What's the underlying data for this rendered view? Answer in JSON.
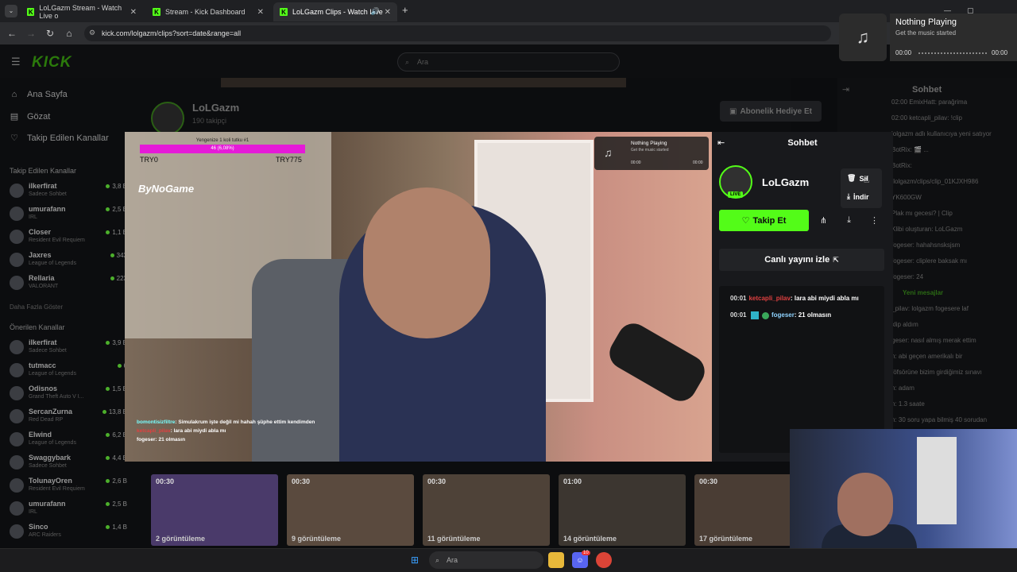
{
  "browser": {
    "tabs": [
      {
        "label": "LoLGazm Stream - Watch Live o"
      },
      {
        "label": "Stream - Kick Dashboard"
      },
      {
        "label": "LoLGazm Clips - Watch Live"
      }
    ],
    "new_tab": "+",
    "url": "kick.com/lolgazm/clips?sort=date&range=all"
  },
  "kick": {
    "logo": "KICK",
    "search_placeholder": "Ara"
  },
  "sidebar": {
    "nav": [
      {
        "label": "Ana Sayfa",
        "icon": "home-icon"
      },
      {
        "label": "Gözat",
        "icon": "browse-icon"
      },
      {
        "label": "Takip Edilen Kanallar",
        "icon": "heart-icon"
      }
    ],
    "followed_heading": "Takip Edilen Kanallar",
    "followed": [
      {
        "name": "ilkerfirat",
        "game": "Sadece Sohbet",
        "viewers": "3,8 B"
      },
      {
        "name": "umurafann",
        "game": "IRL",
        "viewers": "2,5 B"
      },
      {
        "name": "Closer",
        "game": "Resident Evil Requiem",
        "viewers": "1,1 B"
      },
      {
        "name": "Jaxres",
        "game": "League of Legends",
        "viewers": "343"
      },
      {
        "name": "Rellaria",
        "game": "VALORANT",
        "viewers": "223"
      }
    ],
    "show_more": "Daha Fazla Göster",
    "recommended_heading": "Önerilen Kanallar",
    "recommended": [
      {
        "name": "ilkerfirat",
        "game": "Sadece Sohbet",
        "viewers": "3,9 B"
      },
      {
        "name": "tutmacc",
        "game": "League of Legends",
        "viewers": "6"
      },
      {
        "name": "Odisnos",
        "game": "Grand Theft Auto V I...",
        "viewers": "1,5 B"
      },
      {
        "name": "SercanZurna",
        "game": "Red Dead RP",
        "viewers": "13,8 B"
      },
      {
        "name": "Elwind",
        "game": "League of Legends",
        "viewers": "6,2 B"
      },
      {
        "name": "Swaggybark",
        "game": "Sadece Sohbet",
        "viewers": "4,4 B"
      },
      {
        "name": "TolunayOren",
        "game": "Resident Evil Requiem",
        "viewers": "2,6 B"
      },
      {
        "name": "umurafann",
        "game": "IRL",
        "viewers": "2,5 B"
      },
      {
        "name": "Sinco",
        "game": "ARC Raiders",
        "viewers": "1,4 B"
      }
    ]
  },
  "channel": {
    "name": "LoLGazm",
    "followers": "190 takipçi",
    "gift_sub": "Abonelik Hediye Et"
  },
  "clips": [
    {
      "duration": "00:30",
      "views": "2 görüntüleme"
    },
    {
      "duration": "00:30",
      "views": "9 görüntüleme"
    },
    {
      "duration": "00:30",
      "views": "11 görüntüleme"
    },
    {
      "duration": "01:00",
      "views": "14 görüntüleme"
    },
    {
      "duration": "00:30",
      "views": "17 görüntüleme"
    }
  ],
  "video_overlay": {
    "goal_text": "Yengenize 1 koli tutku #1",
    "goal_progress": "46 (6,08%)",
    "try_left": "TRY0",
    "try_right": "TRY775",
    "brand": "ByNoGame",
    "chat": [
      {
        "user": "bomontisizfiltre",
        "text": ": Simulakrum işte değil mi hahah şüphe ettim kendimden"
      },
      {
        "user": "ketcapli_pilav",
        "text": ": lara abi miydi abla mı"
      },
      {
        "user": "fogeser",
        "text": ": 21 olmasın"
      }
    ],
    "np_title": "Nothing Playing",
    "np_sub": "Get the music started",
    "np_t0": "00:00",
    "np_t1": "00:00"
  },
  "panel": {
    "title": "Sohbet",
    "streamer": "LoLGazm",
    "live": "LIVE",
    "follow": "Takip Et",
    "watch_live": "Canlı yayını izle",
    "messages": [
      {
        "time": "00:01",
        "user": "ketcapli_pilav",
        "text": ": lara abi miydi abla mı"
      },
      {
        "time": "00:01",
        "user": "fogeser",
        "text": ": 21 olmasın"
      }
    ],
    "menu": [
      {
        "label": "Sil",
        "icon": "trash-icon"
      },
      {
        "label": "İndir",
        "icon": "download-icon"
      }
    ]
  },
  "right_chat": {
    "title": "Sohbet",
    "lines": [
      "02:00 EmixHatt: parağrima",
      "02:00 ketcapli_pilav: !clip",
      "lolgazm adlı kullanıcıya yeni satıyor",
      "BotRix: 🎬 ...",
      "BotRix:",
      "/lolgazm/clips/clip_01KJXH986",
      "YK600GW",
      "Plak mı gecesi? | Clip",
      "Klibi oluşturan: LoLGazm",
      "fogeser: hahahsnsksjsm",
      "fogeser: cliplere baksak mı",
      "fogeser: 24",
      "Yeni mesajlar",
      "_pilav: lolgazm fogesere laf",
      "klip aldım",
      "geser: nasıl almış merak ettim",
      "n: abi geçen amerikalı bir",
      "föfsörüne bizim girdiğimiz sınavı",
      "n: adam",
      "n: 1.3 saate",
      "n: 30 soru yapa bilmiş 40 sorudan"
    ]
  },
  "now_playing": {
    "title": "Nothing Playing",
    "subtitle": "Get the music started",
    "time_start": "00:00",
    "time_end": "00:00"
  },
  "taskbar": {
    "search_placeholder": "Ara",
    "badge": "10"
  }
}
